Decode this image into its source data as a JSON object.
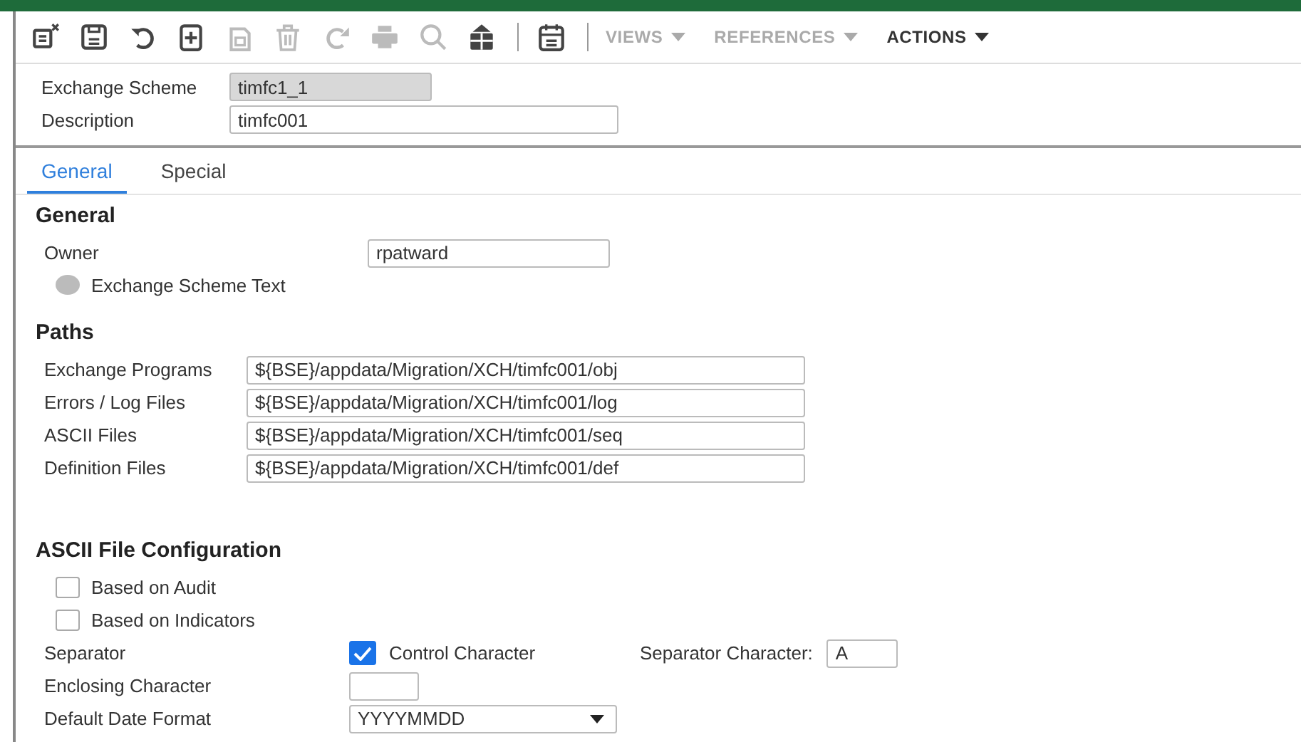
{
  "toolbar": {
    "buttons": [
      {
        "disabled": false
      },
      {
        "disabled": false
      },
      {
        "disabled": false
      },
      {
        "disabled": false
      },
      {
        "disabled": true
      },
      {
        "disabled": true
      },
      {
        "disabled": true
      },
      {
        "disabled": true
      },
      {
        "disabled": true
      },
      {
        "disabled": false
      },
      {
        "disabled": false
      }
    ],
    "menus": [
      {
        "label": "VIEWS",
        "disabled": true
      },
      {
        "label": "REFERENCES",
        "disabled": true
      },
      {
        "label": "ACTIONS",
        "disabled": false
      }
    ]
  },
  "header": [
    {
      "label": "Exchange Scheme",
      "value": "timfc1_1",
      "disabled": true
    },
    {
      "label": "Description",
      "value": "timfc001",
      "disabled": false
    }
  ],
  "tabs": [
    {
      "label": "General",
      "selected": true
    },
    {
      "label": "Special",
      "selected": false
    }
  ],
  "general": {
    "title": "General",
    "owner_label": "Owner",
    "owner": "rpatward",
    "text_option": {
      "label": "Exchange Scheme Text",
      "disabled": true
    }
  },
  "paths": {
    "title": "Paths",
    "rows": [
      {
        "label": "Exchange Programs",
        "value": "${BSE}/appdata/Migration/XCH/timfc001/obj"
      },
      {
        "label": "Errors / Log Files",
        "value": "${BSE}/appdata/Migration/XCH/timfc001/log"
      },
      {
        "label": "ASCII Files",
        "value": "${BSE}/appdata/Migration/XCH/timfc001/seq"
      },
      {
        "label": "Definition Files",
        "value": "${BSE}/appdata/Migration/XCH/timfc001/def"
      }
    ]
  },
  "ascii": {
    "title": "ASCII File Configuration",
    "checks": [
      {
        "label": "Based on Audit",
        "checked": false
      },
      {
        "label": "Based on Indicators",
        "checked": false
      }
    ],
    "separator_label": "Separator",
    "control_character": {
      "label": "Control Character",
      "checked": true
    },
    "separator_character_label": "Separator Character:",
    "separator_character": "A",
    "enclosing_label": "Enclosing Character",
    "date_format_label": "Default Date Format",
    "date_format": "YYYYMMDD"
  }
}
